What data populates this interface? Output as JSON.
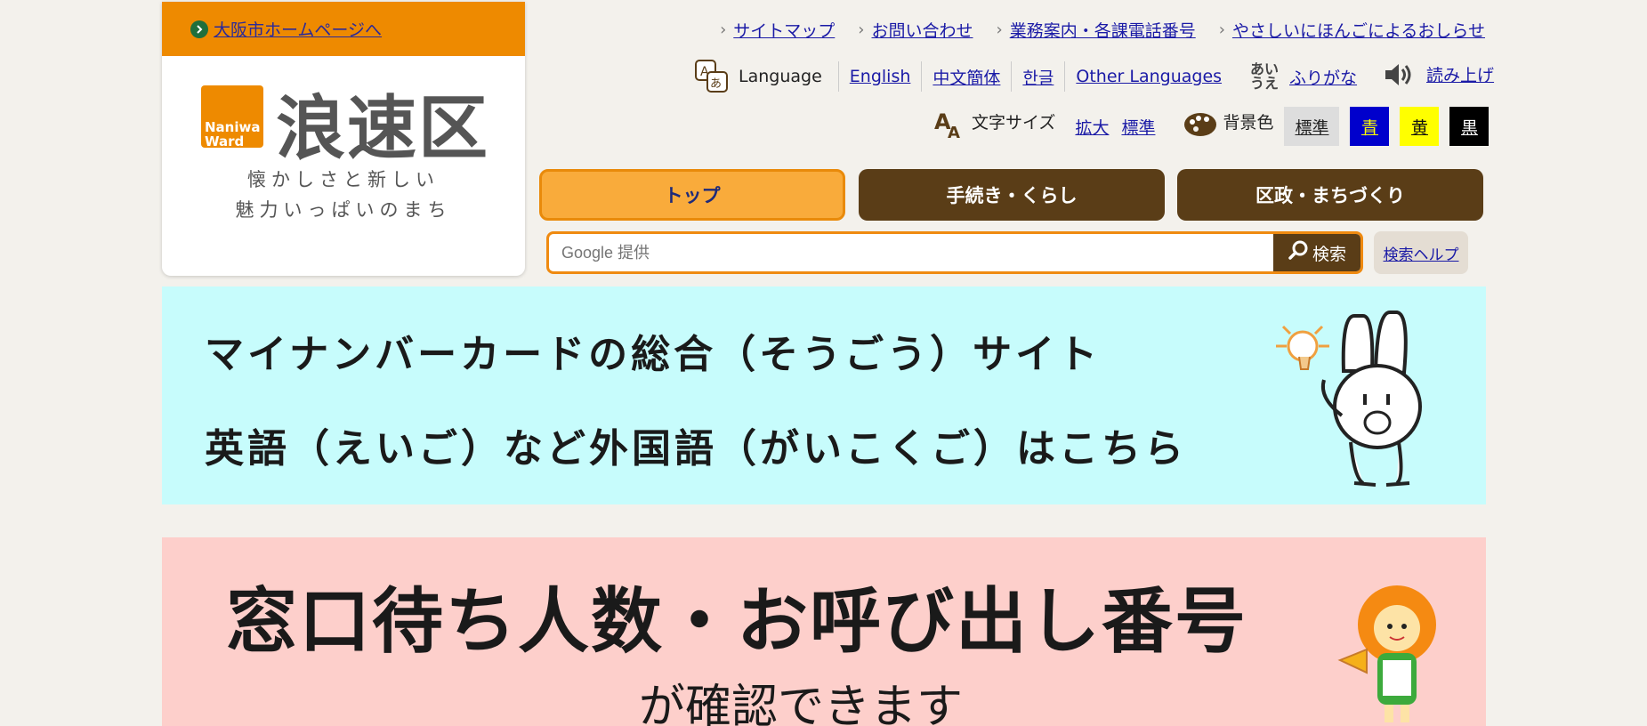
{
  "header": {
    "osaka_link": "大阪市ホームページへ",
    "logo_text": "Naniwa Ward",
    "ward_name": "浪速区",
    "slogan_line1": "懐かしさと新しい",
    "slogan_line2": "魅力いっぱいのまち"
  },
  "util_links": [
    {
      "label": "サイトマップ"
    },
    {
      "label": "お問い合わせ"
    },
    {
      "label": "業務案内・各課電話番号"
    },
    {
      "label": "やさしいにほんごによるおしらせ"
    }
  ],
  "language": {
    "label": "Language",
    "options": [
      "English",
      "中文簡体",
      "한글",
      "Other Languages"
    ],
    "furigana_icon": "あいうえ",
    "furigana": "ふりがな",
    "read_aloud": "読み上げ"
  },
  "text_size": {
    "label": "文字サイズ",
    "enlarge": "拡大",
    "standard": "標準"
  },
  "bg_color": {
    "label": "背景色",
    "options": [
      {
        "label": "標準",
        "bg": "#dddddd",
        "fg": "#222222"
      },
      {
        "label": "青",
        "bg": "#0000cc",
        "fg": "#ffff00"
      },
      {
        "label": "黄",
        "bg": "#ffff00",
        "fg": "#111111"
      },
      {
        "label": "黒",
        "bg": "#000000",
        "fg": "#ffffff"
      }
    ]
  },
  "nav": {
    "top": "トップ",
    "life": "手続き・くらし",
    "govt": "区政・まちづくり"
  },
  "search": {
    "placeholder": "Google 提供",
    "button": "検索",
    "help": "検索ヘルプ"
  },
  "banners": {
    "mynumber_line1": "マイナンバーカードの総合（そうごう）サイト",
    "mynumber_line2": "英語（えいご）など外国語（がいこくご）はこちら",
    "queue_title": "窓口待ち人数・お呼び出し番号",
    "queue_sub": "が確認できます"
  },
  "colors": {
    "accent_orange": "#ee8a00",
    "brown": "#5a3d17",
    "banner_cyan": "#c7fcfc",
    "banner_pink": "#fdcfcb"
  }
}
